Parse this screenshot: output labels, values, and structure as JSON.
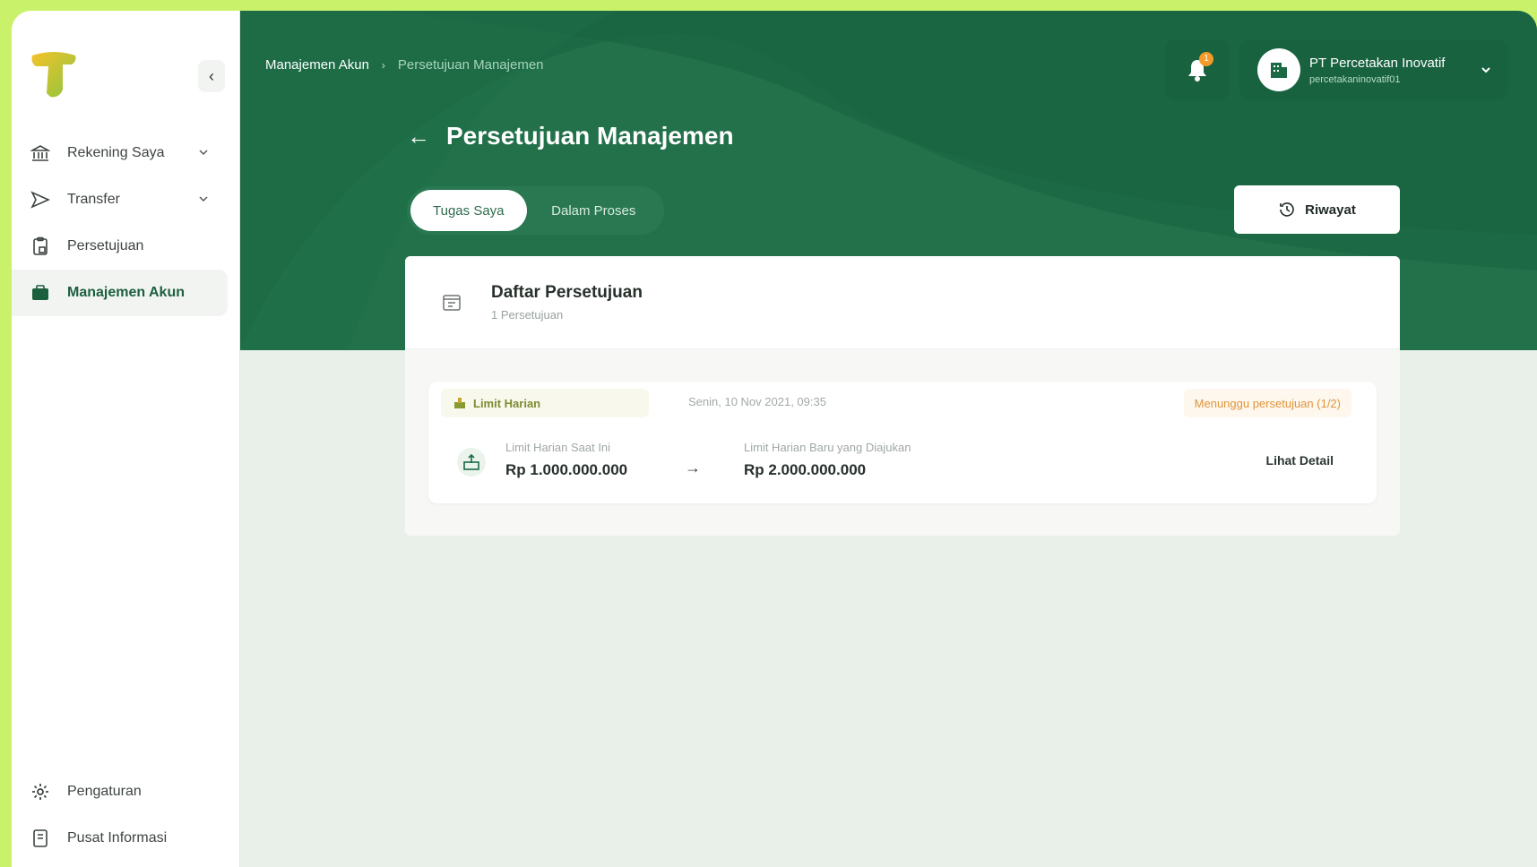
{
  "sidebar": {
    "items": [
      {
        "label": "Rekening Saya",
        "icon": "bank-icon"
      },
      {
        "label": "Transfer",
        "icon": "send-icon"
      },
      {
        "label": "Persetujuan",
        "icon": "clipboard-icon"
      },
      {
        "label": "Manajemen Akun",
        "icon": "briefcase-icon"
      }
    ],
    "bottom": [
      {
        "label": "Pengaturan",
        "icon": "gear-icon"
      },
      {
        "label": "Pusat Informasi",
        "icon": "book-icon"
      }
    ]
  },
  "header": {
    "breadcrumb": [
      "Manajemen Akun",
      "Persetujuan Manajemen"
    ],
    "notification_count": "1",
    "account": {
      "name": "PT Percetakan Inovatif",
      "username": "percetakaninovatif01"
    }
  },
  "page": {
    "title": "Persetujuan Manajemen",
    "tabs": [
      "Tugas Saya",
      "Dalam Proses"
    ],
    "history_button": "Riwayat"
  },
  "list": {
    "title": "Daftar Persetujuan",
    "count": "1 Persetujuan",
    "items": [
      {
        "tag": "Limit Harian",
        "date": "Senin, 10 Nov 2021, 09:35",
        "status": "Menunggu persetujuan (1/2)",
        "current_label": "Limit Harian Saat Ini",
        "current_value": "Rp 1.000.000.000",
        "new_label": "Limit Harian Baru yang Diajukan",
        "new_value": "Rp 2.000.000.000",
        "detail_link": "Lihat Detail"
      }
    ]
  },
  "colors": {
    "brand_green": "#1c6a45",
    "accent_lime": "#c9f26a",
    "warning": "#e0953a"
  }
}
